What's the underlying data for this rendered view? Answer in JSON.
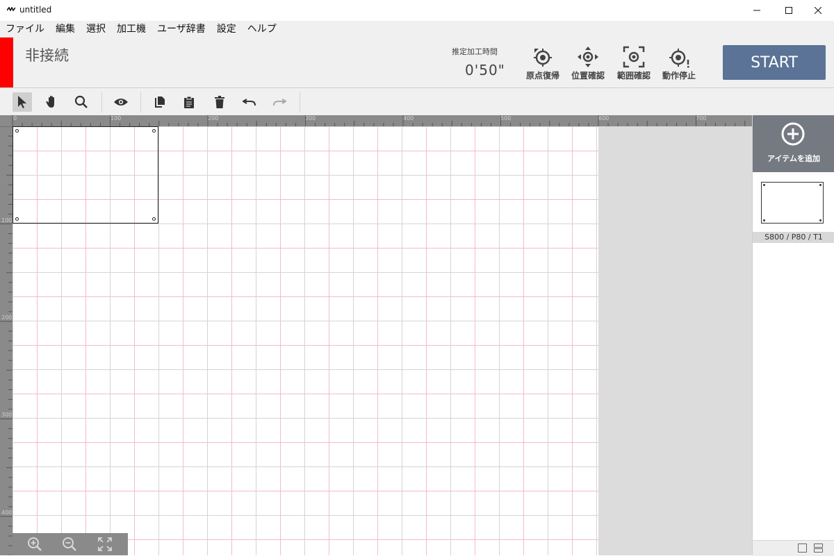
{
  "window": {
    "title": "untitled"
  },
  "menu": [
    "ファイル",
    "編集",
    "選択",
    "加工機",
    "ユーザ辞書",
    "設定",
    "ヘルプ"
  ],
  "status": {
    "connection": "非接続",
    "connection_color": "#ff0000",
    "estimated_time_label": "推定加工時間",
    "estimated_time_value": "0'50\""
  },
  "controls": {
    "origin_return": "原点復帰",
    "position_check": "位置確認",
    "range_check": "範囲確認",
    "stop": "動作停止",
    "start": "START"
  },
  "ruler": {
    "horizontal_labels": [
      "0",
      "100",
      "200",
      "300",
      "400",
      "500",
      "600",
      "700"
    ],
    "vertical_labels": [
      "100",
      "200",
      "300",
      "400"
    ]
  },
  "side_panel": {
    "add_item_label": "アイテムを追加",
    "item_params": "S800 / P80 / T1"
  },
  "colors": {
    "start_button": "#5a7396",
    "add_item_bg": "#757a82",
    "ruler": "#8a8a8a"
  }
}
